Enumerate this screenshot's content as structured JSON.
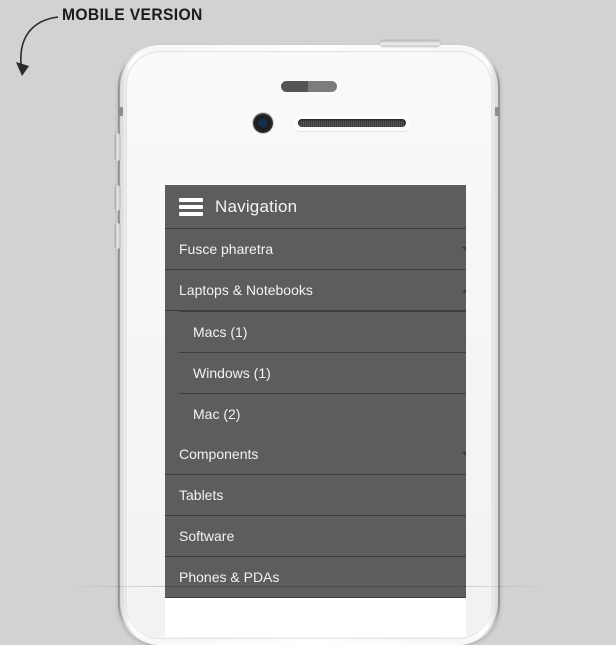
{
  "caption": "MOBILE VERSION",
  "arrow": {
    "name": "curved-down-arrow"
  },
  "phone": {
    "parts": {
      "sensor": "proximity-sensor",
      "camera": "front-camera",
      "earpiece": "earpiece-speaker",
      "silent_switch": "silent-switch",
      "volume_up": "volume-up-button",
      "volume_down": "volume-down-button",
      "power": "power-button"
    }
  },
  "nav": {
    "header": {
      "title": "Navigation",
      "menu_icon": "hamburger-icon"
    },
    "items": [
      {
        "label": "Fusce pharetra",
        "caret": "down",
        "expanded": false,
        "children": []
      },
      {
        "label": "Laptops & Notebooks",
        "caret": "up",
        "expanded": true,
        "children": [
          {
            "label": "Macs (1)"
          },
          {
            "label": "Windows (1)"
          },
          {
            "label": "Mac (2)"
          }
        ]
      },
      {
        "label": "Components",
        "caret": "down",
        "expanded": false,
        "children": []
      },
      {
        "label": "Tablets",
        "caret": "none",
        "expanded": false,
        "children": []
      },
      {
        "label": "Software",
        "caret": "none",
        "expanded": false,
        "children": []
      },
      {
        "label": "Phones & PDAs",
        "caret": "none",
        "expanded": false,
        "children": []
      }
    ]
  },
  "colors": {
    "page_background": "#d2d2d0",
    "nav_background": "#5d5d5d",
    "nav_separator": "#3e3e3e",
    "nav_text": "#f2f2f2",
    "caret": "#3a3a3a",
    "caption_text": "#1b1b1b",
    "screen_background": "#ffffff"
  }
}
